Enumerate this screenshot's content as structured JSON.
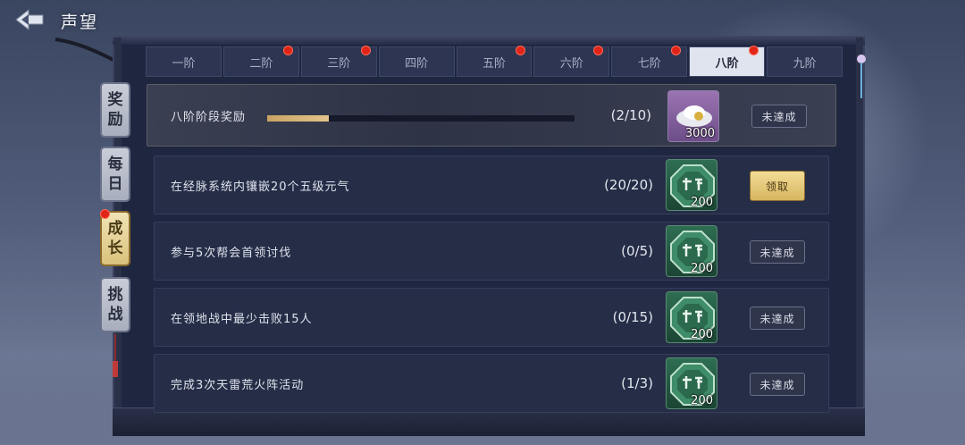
{
  "header": {
    "title": "声望"
  },
  "tabs": [
    {
      "label": "一阶",
      "dot": false,
      "active": false
    },
    {
      "label": "二阶",
      "dot": true,
      "active": false
    },
    {
      "label": "三阶",
      "dot": true,
      "active": false
    },
    {
      "label": "四阶",
      "dot": false,
      "active": false
    },
    {
      "label": "五阶",
      "dot": true,
      "active": false
    },
    {
      "label": "六阶",
      "dot": true,
      "active": false
    },
    {
      "label": "七阶",
      "dot": true,
      "active": false
    },
    {
      "label": "八阶",
      "dot": true,
      "active": true
    },
    {
      "label": "九阶",
      "dot": false,
      "active": false
    }
  ],
  "side_tabs": [
    {
      "chars": [
        "奖",
        "励"
      ],
      "active": false,
      "dot": false
    },
    {
      "chars": [
        "每",
        "日"
      ],
      "active": false,
      "dot": false
    },
    {
      "chars": [
        "成",
        "长"
      ],
      "active": true,
      "dot": true
    },
    {
      "chars": [
        "挑",
        "战"
      ],
      "active": false,
      "dot": false
    }
  ],
  "summary": {
    "label": "八阶阶段奖励",
    "progress_fraction": 0.2,
    "count": "(2/10)",
    "reward_qty": "3000",
    "button": "未達成"
  },
  "tasks": [
    {
      "label": "在经脉系统内镶嵌20个五级元气",
      "count": "(20/20)",
      "reward_qty": "200",
      "button": "领取",
      "claimable": true
    },
    {
      "label": "参与5次帮会首领讨伐",
      "count": "(0/5)",
      "reward_qty": "200",
      "button": "未達成",
      "claimable": false
    },
    {
      "label": "在领地战中最少击败15人",
      "count": "(0/15)",
      "reward_qty": "200",
      "button": "未達成",
      "claimable": false
    },
    {
      "label": "完成3次天雷荒火阵活动",
      "count": "(1/3)",
      "reward_qty": "200",
      "button": "未達成",
      "claimable": false
    }
  ],
  "colors": {
    "accent_gold": "#d6b660",
    "badge_red": "#e02418",
    "panel": "#1f2640"
  }
}
